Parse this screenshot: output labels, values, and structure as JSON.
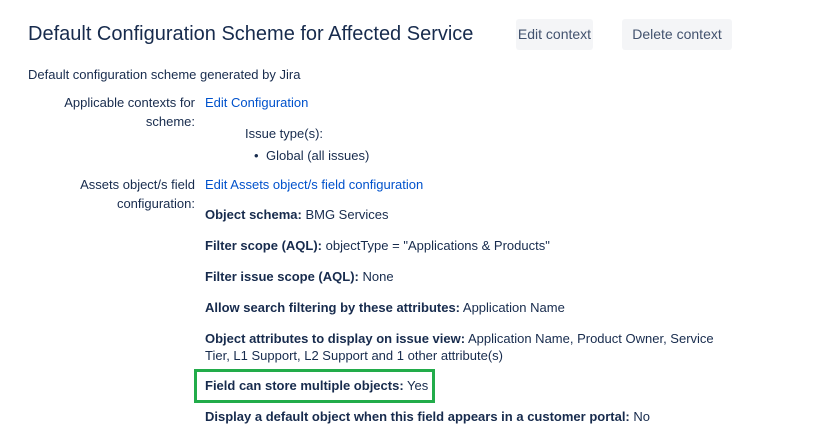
{
  "header": {
    "title": "Default Configuration Scheme for Affected Service",
    "edit_context": "Edit context",
    "delete_context": "Delete context"
  },
  "description": "Default configuration scheme generated by Jira",
  "contexts": {
    "label_line1": "Applicable contexts for",
    "label_line2": "scheme:",
    "link": "Edit Configuration",
    "issue_types_label": "Issue type(s):",
    "issue_types": [
      "Global (all issues)"
    ]
  },
  "assets": {
    "label_line1": "Assets object/s field",
    "label_line2": "configuration:",
    "link": "Edit Assets object/s field configuration",
    "rows": [
      {
        "key": "Object schema:",
        "value": "BMG Services"
      },
      {
        "key": "Filter scope (AQL):",
        "value": "objectType = \"Applications & Products\""
      },
      {
        "key": "Filter issue scope (AQL):",
        "value": "None"
      },
      {
        "key": "Allow search filtering by these attributes:",
        "value": "Application Name"
      },
      {
        "key": "Object attributes to display on issue view:",
        "value": "Application Name, Product Owner, Service",
        "value_line2": "Tier, L1 Support, L2 Support and 1 other attribute(s)"
      },
      {
        "key": "Field can store multiple objects:",
        "value": "Yes"
      },
      {
        "key": "Display a default object when this field appears in a customer portal:",
        "value": "No"
      }
    ]
  },
  "highlight_color": "#22ac4a"
}
